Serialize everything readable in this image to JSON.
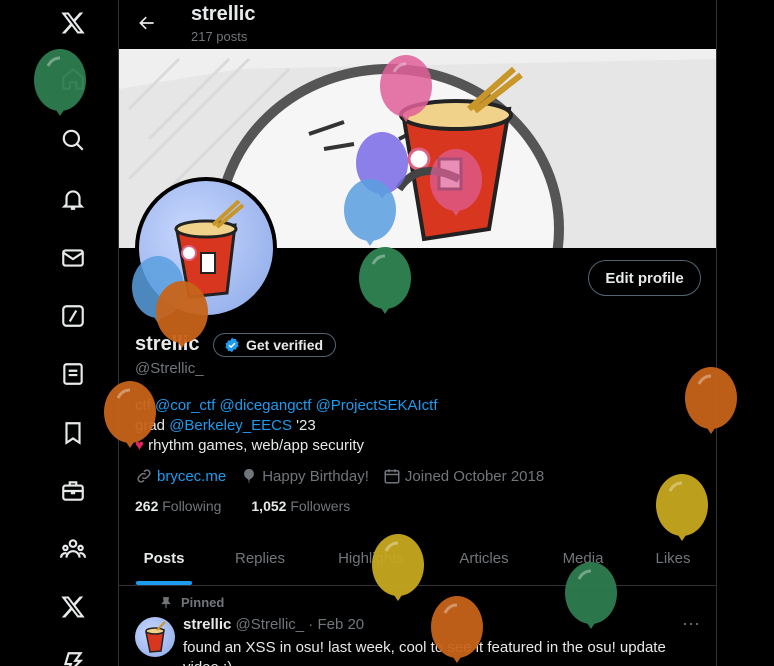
{
  "nav": {
    "items": [
      {
        "name": "x-logo-icon"
      },
      {
        "name": "home-icon"
      },
      {
        "name": "search-icon"
      },
      {
        "name": "notifications-icon"
      },
      {
        "name": "messages-icon"
      },
      {
        "name": "grok-icon"
      },
      {
        "name": "lists-icon"
      },
      {
        "name": "bookmarks-icon"
      },
      {
        "name": "jobs-icon"
      },
      {
        "name": "communities-icon"
      },
      {
        "name": "premium-icon"
      },
      {
        "name": "verified-orgs-icon"
      }
    ]
  },
  "header": {
    "name": "strellic",
    "post_count": "217 posts"
  },
  "profile": {
    "display_name": "strellic",
    "get_verified_label": "Get verified",
    "handle": "@Strellic_",
    "edit_profile_label": "Edit profile",
    "bio": {
      "line1_prefix": "ctf ",
      "line1_mentions": [
        "@cor_ctf",
        "@dicegangctf",
        "@ProjectSEKAIctf"
      ],
      "line2_prefix": "grad ",
      "line2_mention": "@Berkeley_EECS",
      "line2_suffix": " '23",
      "line3_text": "rhythm games, web/app security"
    },
    "meta": {
      "website": "brycec.me",
      "birthday": "Happy Birthday!",
      "joined": "Joined October 2018"
    },
    "following_count": "262",
    "following_label": "Following",
    "followers_count": "1,052",
    "followers_label": "Followers"
  },
  "tabs": [
    {
      "label": "Posts",
      "active": true
    },
    {
      "label": "Replies",
      "active": false
    },
    {
      "label": "Highlights",
      "active": false
    },
    {
      "label": "Articles",
      "active": false
    },
    {
      "label": "Media",
      "active": false
    },
    {
      "label": "Likes",
      "active": false
    }
  ],
  "pinned_post": {
    "pinned_label": "Pinned",
    "author": "strellic",
    "handle_date": "@Strellic_ · Feb 20",
    "text": "found an XSS in osu! last week, cool to see it featured in the osu! update video :)"
  },
  "colors": {
    "accent": "#1d9bf0",
    "background": "#000000",
    "muted": "#71767b",
    "balloon_green": "#2e7d4f",
    "balloon_orange": "#c8641a",
    "balloon_yellow": "#c8a820",
    "balloon_blue": "#5a9fe0",
    "balloon_purple": "#7a6be8",
    "balloon_pink": "#e0609a"
  }
}
